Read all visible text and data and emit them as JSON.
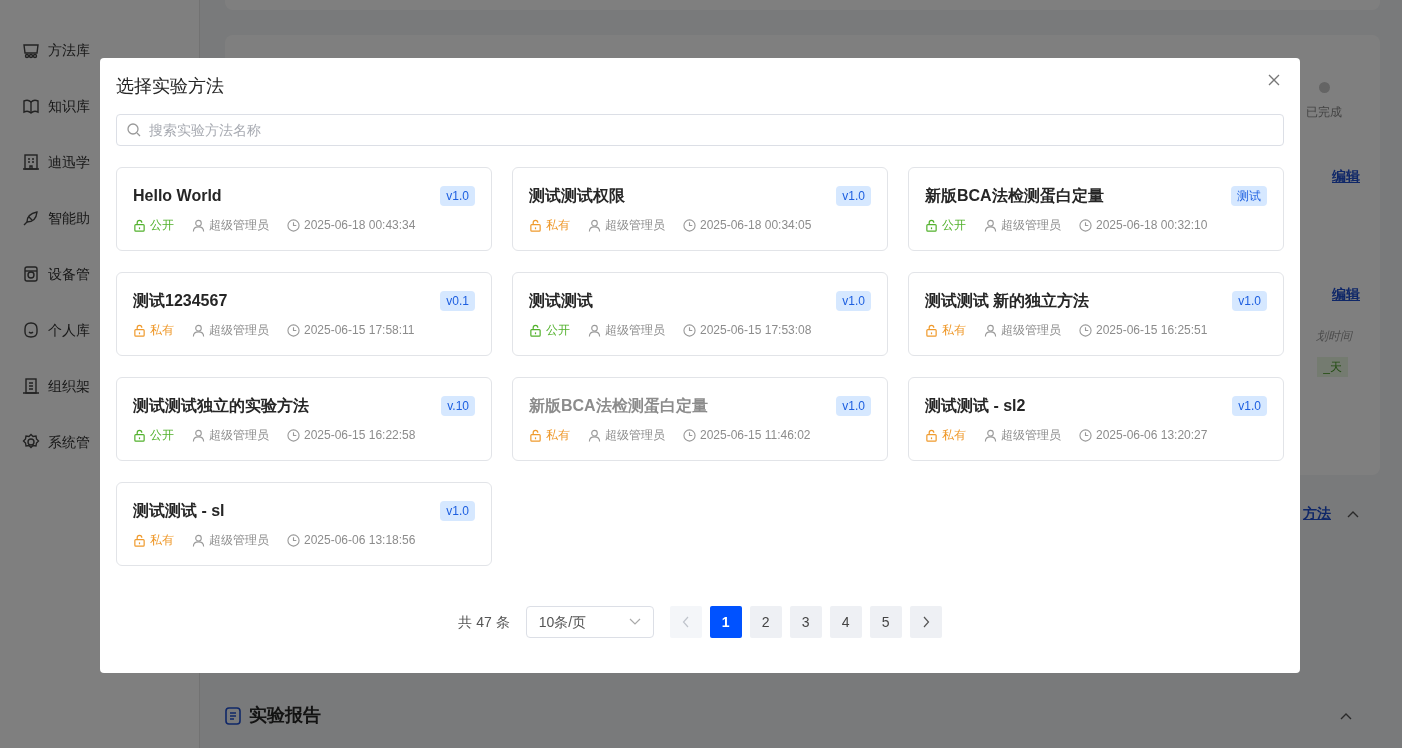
{
  "sidebar": {
    "items": [
      {
        "label": "方法库"
      },
      {
        "label": "知识库"
      },
      {
        "label": "迪迅学"
      },
      {
        "label": "智能助"
      },
      {
        "label": "设备管"
      },
      {
        "label": "个人库"
      },
      {
        "label": "组织架"
      },
      {
        "label": "系统管"
      }
    ]
  },
  "background": {
    "status_label": "已完成",
    "edit_links": [
      "编辑",
      "编辑"
    ],
    "column_header": "划时间",
    "duration_tag": "_天",
    "section_link": "方法",
    "report_title": "实验报告"
  },
  "dialog": {
    "title": "选择实验方法",
    "search": {
      "placeholder": "搜索实验方法名称"
    },
    "methods": [
      {
        "name": "Hello World",
        "version": "v1.0",
        "kind": "public",
        "visibility": "公开",
        "owner": "超级管理员",
        "time": "2025-06-18 00:43:34",
        "disabled": false
      },
      {
        "name": "测试测试权限",
        "version": "v1.0",
        "kind": "private",
        "visibility": "私有",
        "owner": "超级管理员",
        "time": "2025-06-18 00:34:05",
        "disabled": false
      },
      {
        "name": "新版BCA法检测蛋白定量",
        "version": "测试",
        "kind": "public",
        "visibility": "公开",
        "owner": "超级管理员",
        "time": "2025-06-18 00:32:10",
        "disabled": false
      },
      {
        "name": "测试1234567",
        "version": "v0.1",
        "kind": "private",
        "visibility": "私有",
        "owner": "超级管理员",
        "time": "2025-06-15 17:58:11",
        "disabled": false
      },
      {
        "name": "测试测试",
        "version": "v1.0",
        "kind": "public",
        "visibility": "公开",
        "owner": "超级管理员",
        "time": "2025-06-15 17:53:08",
        "disabled": false
      },
      {
        "name": "测试测试 新的独立方法",
        "version": "v1.0",
        "kind": "private",
        "visibility": "私有",
        "owner": "超级管理员",
        "time": "2025-06-15 16:25:51",
        "disabled": false
      },
      {
        "name": "测试测试独立的实验方法",
        "version": "v.10",
        "kind": "public",
        "visibility": "公开",
        "owner": "超级管理员",
        "time": "2025-06-15 16:22:58",
        "disabled": false
      },
      {
        "name": "新版BCA法检测蛋白定量",
        "version": "v1.0",
        "kind": "private",
        "visibility": "私有",
        "owner": "超级管理员",
        "time": "2025-06-15 11:46:02",
        "disabled": true
      },
      {
        "name": "测试测试 - sl2",
        "version": "v1.0",
        "kind": "private",
        "visibility": "私有",
        "owner": "超级管理员",
        "time": "2025-06-06 13:20:27",
        "disabled": false
      },
      {
        "name": "测试测试 - sl",
        "version": "v1.0",
        "kind": "private",
        "visibility": "私有",
        "owner": "超级管理员",
        "time": "2025-06-06 13:18:56",
        "disabled": false
      }
    ],
    "pagination": {
      "total": "共 47 条",
      "page_size": "10条/页",
      "prev_disabled": true,
      "pages": [
        {
          "label": "1",
          "selected": true
        },
        {
          "label": "2",
          "selected": false
        },
        {
          "label": "3",
          "selected": false
        },
        {
          "label": "4",
          "selected": false
        },
        {
          "label": "5",
          "selected": false
        }
      ]
    }
  }
}
